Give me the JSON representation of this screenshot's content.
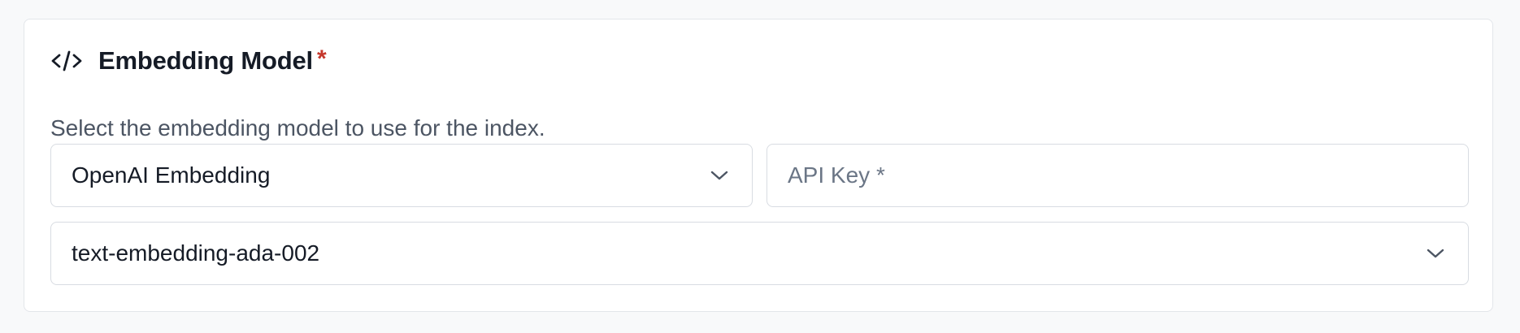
{
  "section": {
    "title": "Embedding Model",
    "required_marker": "*",
    "description": "Select the embedding model to use for the index.",
    "icon": "code-icon"
  },
  "provider_select": {
    "value": "OpenAI Embedding",
    "icon": "chevron-down-icon"
  },
  "api_key": {
    "value": "",
    "placeholder": "API Key *"
  },
  "model_select": {
    "value": "text-embedding-ada-002",
    "icon": "chevron-down-icon"
  },
  "colors": {
    "required": "#c5372c",
    "title": "#151b26",
    "description": "#4c5563",
    "border": "#d8dce2"
  }
}
